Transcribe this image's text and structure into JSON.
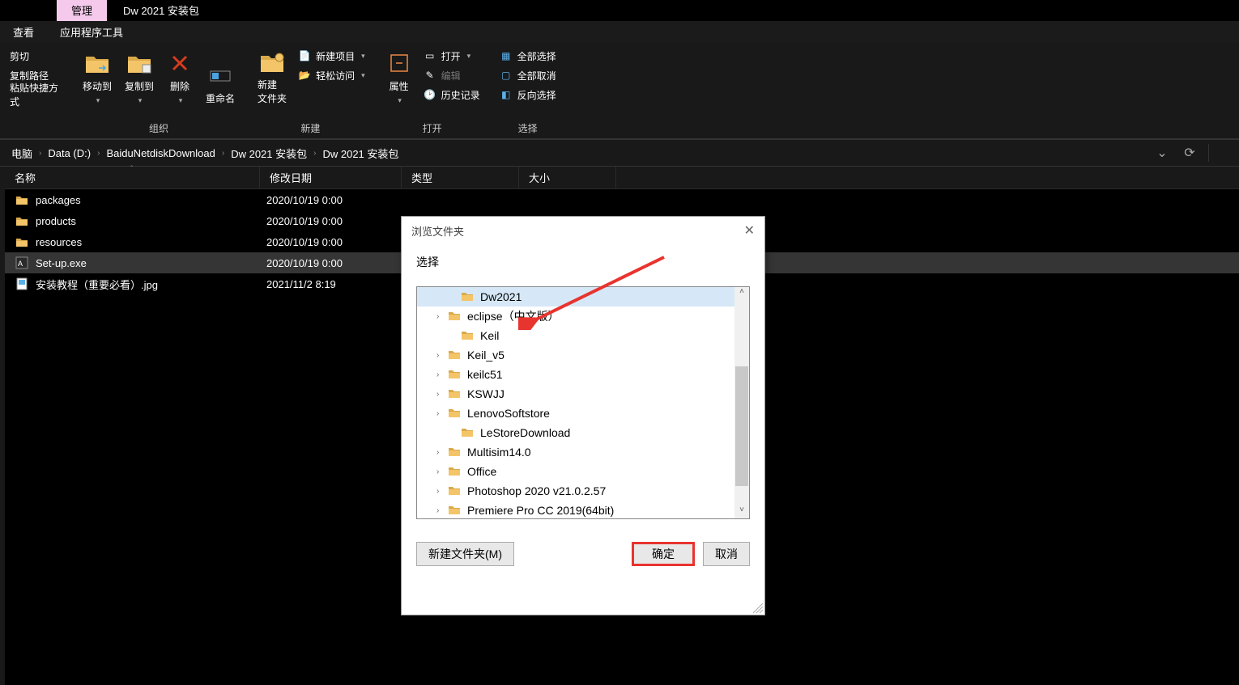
{
  "tabs": {
    "manage": "管理",
    "title": "Dw 2021 安装包",
    "view": "查看",
    "apptools": "应用程序工具"
  },
  "ribbon": {
    "clip": {
      "cut": "剪切",
      "copypath": "复制路径",
      "paste_shortcut": "粘贴快捷方式"
    },
    "org": {
      "moveto": "移动到",
      "copyto": "复制到",
      "delete": "删除",
      "rename": "重命名",
      "label": "组织"
    },
    "new": {
      "newfolder1": "新建",
      "newfolder2": "文件夹",
      "newitem": "新建项目",
      "easyaccess": "轻松访问",
      "label": "新建"
    },
    "open": {
      "properties": "属性",
      "open": "打开",
      "edit": "编辑",
      "history": "历史记录",
      "label": "打开"
    },
    "select": {
      "all": "全部选择",
      "none": "全部取消",
      "invert": "反向选择",
      "label": "选择"
    }
  },
  "breadcrumb": {
    "items": [
      "电脑",
      "Data (D:)",
      "BaiduNetdiskDownload",
      "Dw 2021 安装包",
      "Dw 2021 安装包"
    ]
  },
  "columns": {
    "name": "名称",
    "date": "修改日期",
    "type": "类型",
    "size": "大小"
  },
  "files": [
    {
      "name": "packages",
      "date": "2020/10/19 0:00",
      "icon": "folder"
    },
    {
      "name": "products",
      "date": "2020/10/19 0:00",
      "icon": "folder"
    },
    {
      "name": "resources",
      "date": "2020/10/19 0:00",
      "icon": "folder"
    },
    {
      "name": "Set-up.exe",
      "date": "2020/10/19 0:00",
      "icon": "exe",
      "selected": true
    },
    {
      "name": "安装教程（重要必看）.jpg",
      "date": "2021/11/2 8:19",
      "icon": "image"
    }
  ],
  "dialog": {
    "title": "浏览文件夹",
    "label": "选择",
    "tree": [
      {
        "name": "Dw2021",
        "expander": "none",
        "selected": true,
        "indent": true
      },
      {
        "name": "eclipse（中文版）",
        "expander": ">"
      },
      {
        "name": "Keil",
        "expander": "none",
        "indent": true
      },
      {
        "name": "Keil_v5",
        "expander": ">"
      },
      {
        "name": "keilc51",
        "expander": ">"
      },
      {
        "name": "KSWJJ",
        "expander": ">"
      },
      {
        "name": "LenovoSoftstore",
        "expander": ">"
      },
      {
        "name": "LeStoreDownload",
        "expander": "none",
        "indent": true
      },
      {
        "name": "Multisim14.0",
        "expander": ">"
      },
      {
        "name": "Office",
        "expander": ">"
      },
      {
        "name": "Photoshop 2020 v21.0.2.57",
        "expander": ">"
      },
      {
        "name": "Premiere Pro CC 2019(64bit)",
        "expander": ">"
      }
    ],
    "newfolder": "新建文件夹(M)",
    "ok": "确定",
    "cancel": "取消"
  }
}
